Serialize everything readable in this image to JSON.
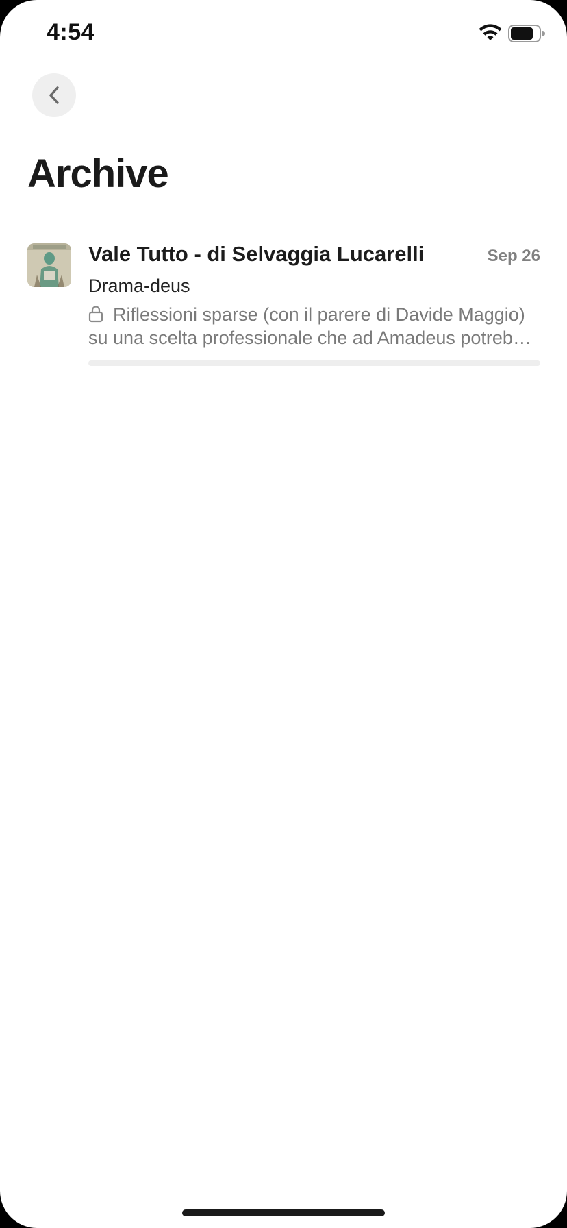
{
  "status_bar": {
    "time": "4:54",
    "wifi_icon": "wifi-icon",
    "battery_icon": "battery-icon"
  },
  "nav": {
    "back_icon": "chevron-left-icon"
  },
  "page": {
    "title": "Archive"
  },
  "archive": {
    "items": [
      {
        "publication": "Vale Tutto - di Selvaggia Lucarelli",
        "date": "Sep 26",
        "title": "Drama-deus",
        "preview": "Riflessioni sparse (con il parere di Davide Maggio) su una scelta professionale che ad Amadeus potrebbe costare più cara di quanto immagina",
        "locked": true,
        "lock_icon": "lock-icon",
        "progress": 0
      }
    ]
  },
  "colors": {
    "background": "#ffffff",
    "title_text": "#1a1a1a",
    "secondary_text": "#7a7a7a",
    "back_button_bg": "#efefef"
  }
}
